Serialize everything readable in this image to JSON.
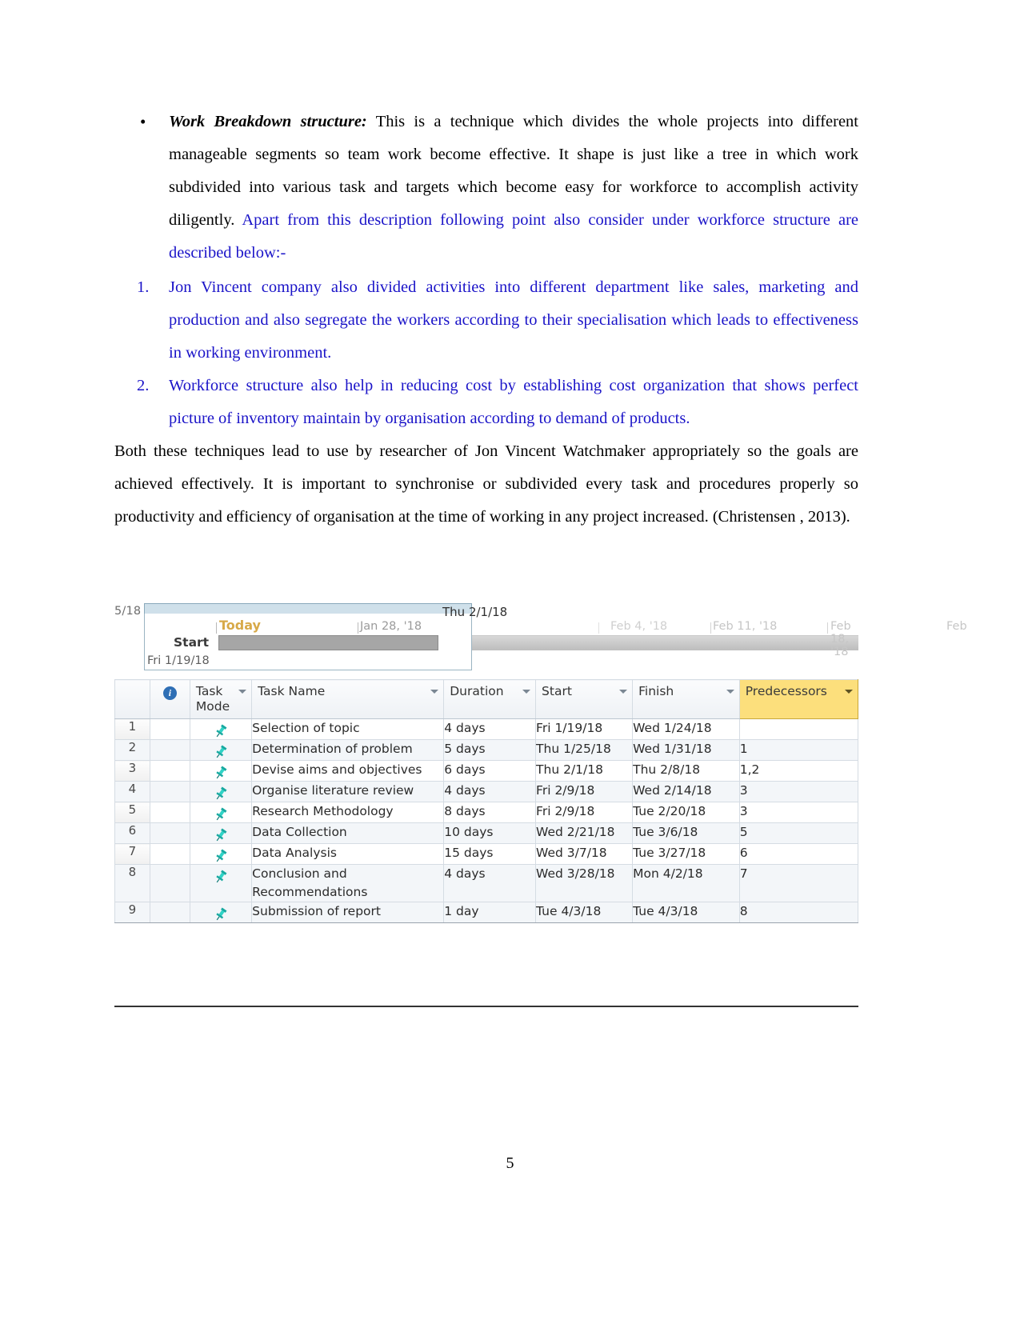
{
  "document": {
    "page_number": "5",
    "bullet": {
      "marker": "•",
      "lead": "Work Breakdown structure:",
      "black_text": " This is a technique which divides the whole projects into different manageable segments so team work become effective. It shape is just like a tree in which work subdivided into various task and targets which become easy for workforce to accomplish activity diligently.",
      "blue_text": " Apart from this description following point also consider under workforce structure are described below:-"
    },
    "numbered_items": [
      {
        "marker": "1.",
        "text": "Jon Vincent company also divided activities into different department like sales, marketing and production and also segregate the workers according to their specialisation which leads to effectiveness in working environment."
      },
      {
        "marker": "2.",
        "text": "Workforce structure also help in reducing cost by establishing cost organization that shows perfect picture of inventory maintain by organisation according to demand of products."
      }
    ],
    "paragraph": "Both these techniques lead to use by researcher of Jon Vincent Watchmaker appropriately so the goals are achieved effectively. It is important to synchronise or subdivided every task and procedures properly so productivity and efficiency of organisation at the time of working in any project increased. (Christensen , 2013).",
    "colors": {
      "blue_text": "#1a13c8",
      "black_text": "#000000",
      "predecessors_header": "#fcdf7c",
      "today_label": "#d7a948"
    }
  },
  "gantt": {
    "timeline": {
      "left_clipped_date": "5/18",
      "today_label": "Today",
      "start_label": "Start",
      "start_date": "Fri 1/19/18",
      "finish_marker": "Thu 2/1/18",
      "ticks": [
        "Jan 28, '18",
        "Feb 4, '18",
        "Feb 11, '18",
        "Feb 18, '18",
        "Feb"
      ]
    },
    "table": {
      "columns": [
        {
          "key": "rownum",
          "label": ""
        },
        {
          "key": "indicator",
          "label": "",
          "icon": "info-icon"
        },
        {
          "key": "mode",
          "label": "Task\nMode",
          "line1": "Task",
          "line2": "Mode"
        },
        {
          "key": "name",
          "label": "Task Name"
        },
        {
          "key": "duration",
          "label": "Duration"
        },
        {
          "key": "start",
          "label": "Start"
        },
        {
          "key": "finish",
          "label": "Finish"
        },
        {
          "key": "predecessors",
          "label": "Predecessors"
        }
      ],
      "rows": [
        {
          "num": "1",
          "mode_icon": "pushpin-icon",
          "name": "Selection of topic",
          "duration": "4 days",
          "start": "Fri 1/19/18",
          "finish": "Wed 1/24/18",
          "predecessors": ""
        },
        {
          "num": "2",
          "mode_icon": "pushpin-icon",
          "name": "Determination of problem",
          "duration": "5 days",
          "start": "Thu 1/25/18",
          "finish": "Wed 1/31/18",
          "predecessors": "1"
        },
        {
          "num": "3",
          "mode_icon": "pushpin-icon",
          "name": "Devise aims and objectives",
          "duration": "6 days",
          "start": "Thu 2/1/18",
          "finish": "Thu 2/8/18",
          "predecessors": "1,2"
        },
        {
          "num": "4",
          "mode_icon": "pushpin-icon",
          "name": "Organise literature review",
          "duration": "4 days",
          "start": "Fri 2/9/18",
          "finish": "Wed 2/14/18",
          "predecessors": "3"
        },
        {
          "num": "5",
          "mode_icon": "pushpin-icon",
          "name": "Research Methodology",
          "duration": "8 days",
          "start": "Fri 2/9/18",
          "finish": "Tue 2/20/18",
          "predecessors": "3"
        },
        {
          "num": "6",
          "mode_icon": "pushpin-icon",
          "name": "Data Collection",
          "duration": "10 days",
          "start": "Wed 2/21/18",
          "finish": "Tue 3/6/18",
          "predecessors": "5"
        },
        {
          "num": "7",
          "mode_icon": "pushpin-icon",
          "name": "Data Analysis",
          "duration": "15 days",
          "start": "Wed 3/7/18",
          "finish": "Tue 3/27/18",
          "predecessors": "6"
        },
        {
          "num": "8",
          "mode_icon": "pushpin-icon",
          "name": "Conclusion and Recommendations",
          "duration": "4 days",
          "start": "Wed 3/28/18",
          "finish": "Mon 4/2/18",
          "predecessors": "7"
        },
        {
          "num": "9",
          "mode_icon": "pushpin-icon",
          "name": "Submission of report",
          "duration": "1 day",
          "start": "Tue 4/3/18",
          "finish": "Tue 4/3/18",
          "predecessors": "8"
        }
      ]
    }
  }
}
